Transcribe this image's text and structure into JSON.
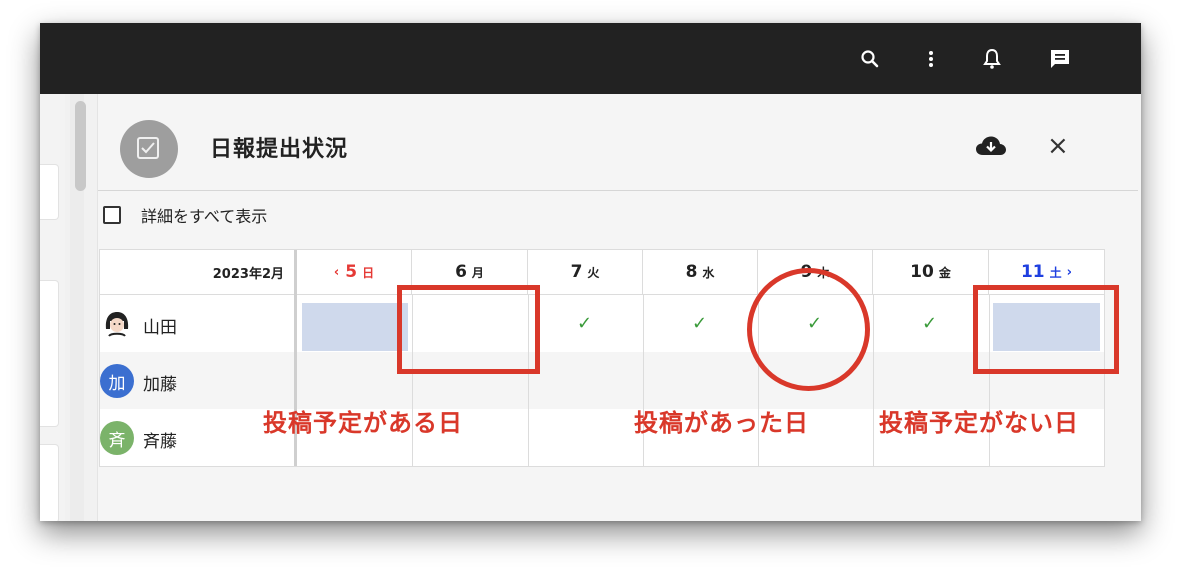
{
  "toolbar": {
    "icons": [
      "search-icon",
      "more-vert-icon",
      "bell-icon",
      "message-icon"
    ]
  },
  "panel": {
    "title": "日報提出状況",
    "header_icons": [
      "check-icon",
      "cloud-download-icon",
      "close-icon"
    ],
    "close_glyph": "×",
    "show_all_label": "詳細をすべて表示"
  },
  "calendar": {
    "month_label": "2023年2月",
    "prev_glyph": "‹",
    "next_glyph": "›",
    "days": [
      {
        "num": "5",
        "dow": "日",
        "color": "#e53935"
      },
      {
        "num": "6",
        "dow": "月",
        "color": "#222222"
      },
      {
        "num": "7",
        "dow": "火",
        "color": "#222222"
      },
      {
        "num": "8",
        "dow": "水",
        "color": "#222222"
      },
      {
        "num": "9",
        "dow": "木",
        "color": "#222222"
      },
      {
        "num": "10",
        "dow": "金",
        "color": "#222222"
      },
      {
        "num": "11",
        "dow": "土",
        "color": "#1e3fe0"
      }
    ],
    "users": [
      {
        "name": "山田",
        "avatar_glyph": "",
        "avatar_color": "#ffffff"
      },
      {
        "name": "加藤",
        "avatar_glyph": "加",
        "avatar_color": "#3b6fd0"
      },
      {
        "name": "斉藤",
        "avatar_glyph": "斉",
        "avatar_color": "#7bb36a"
      }
    ],
    "check_glyph": "✓",
    "highlight_color": "#cfd9ec"
  },
  "annotations": {
    "label_planned": "投稿予定がある日",
    "label_posted": "投稿があった日",
    "label_no_plan": "投稿予定がない日",
    "color": "#d9382a"
  }
}
